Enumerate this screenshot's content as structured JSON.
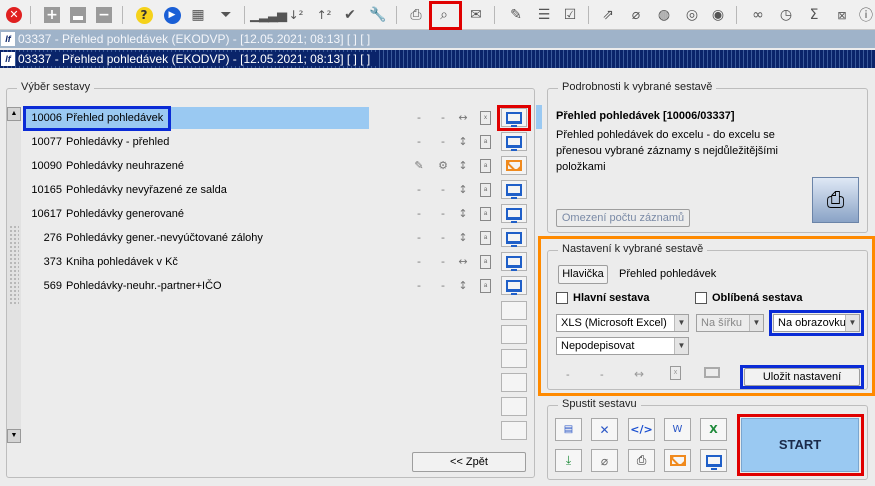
{
  "toolbar": {
    "icons": [
      "close-icon",
      "add-icon",
      "save-icon",
      "remove-icon",
      "help-icon",
      "play-icon",
      "calendar-icon",
      "filter-icon",
      "signal-icon",
      "sort-asc-icon",
      "sort-desc-icon",
      "check-icon",
      "wrench-icon",
      "print-icon",
      "print-preview-icon",
      "mail-icon",
      "edit-icon",
      "list-icon",
      "checklist-icon",
      "export-icon",
      "attach-icon",
      "globe-icon",
      "compass-icon",
      "view-icon",
      "glasses-icon",
      "clock-icon",
      "sum-icon",
      "excel-icon",
      "info-icon"
    ]
  },
  "window1": {
    "title": "03337 - Přehled pohledávek (EKODVP) - [12.05.2021; 08:13]  [ ]  [ ]"
  },
  "window2": {
    "title": "03337 - Přehled pohledávek (EKODVP) - [12.05.2021; 08:13]  [ ]  [ ]"
  },
  "report_list": {
    "label": "Výběr sestavy",
    "items": [
      {
        "code": "10006",
        "name": "Přehled pohledávek",
        "col1": "-",
        "col2": "-",
        "col3": "↔",
        "col4": "xls",
        "output": "monitor",
        "selected": true
      },
      {
        "code": "10077",
        "name": "Pohledávky - přehled",
        "col1": "-",
        "col2": "-",
        "col3": "↕",
        "col4": "pdf",
        "output": "monitor",
        "selected": false
      },
      {
        "code": "10090",
        "name": "Pohledávky neuhrazené",
        "col1": "✎",
        "col2": "⚙",
        "col3": "↕",
        "col4": "pdf",
        "output": "mail",
        "selected": false
      },
      {
        "code": "10165",
        "name": "Pohledávky nevyřazené ze salda",
        "col1": "-",
        "col2": "-",
        "col3": "↕",
        "col4": "pdf",
        "output": "monitor",
        "selected": false
      },
      {
        "code": "10617",
        "name": "Pohledávky generované",
        "col1": "-",
        "col2": "-",
        "col3": "↕",
        "col4": "pdf",
        "output": "monitor",
        "selected": false
      },
      {
        "code": "276",
        "name": "Pohledávky gener.-nevyúčtované zálohy",
        "col1": "-",
        "col2": "-",
        "col3": "↕",
        "col4": "pdf",
        "output": "monitor",
        "selected": false
      },
      {
        "code": "373",
        "name": "Kniha pohledávek v Kč",
        "col1": "-",
        "col2": "-",
        "col3": "↔",
        "col4": "pdf",
        "output": "monitor",
        "selected": false
      },
      {
        "code": "569",
        "name": "Pohledávky-neuhr.-partner+IČO",
        "col1": "-",
        "col2": "-",
        "col3": "↕",
        "col4": "pdf",
        "output": "monitor",
        "selected": false
      }
    ],
    "back_label": "<< Zpět"
  },
  "details": {
    "label": "Podrobnosti k vybrané sestavě",
    "title": "Přehled pohledávek [10006/03337]",
    "description": "Přehled pohledávek do excelu - do excelu se přenesou vybrané záznamy s nejdůležitějšími položkami",
    "limit_label": "Omezení počtu záznamů"
  },
  "settings": {
    "label": "Nastavení k vybrané sestavě",
    "header_btn": "Hlavička",
    "header_value": "Přehled pohledávek",
    "main_label": "Hlavní sestava",
    "favorite_label": "Oblíbená sestava",
    "format": "XLS (Microsoft Excel)",
    "width": "Na šířku",
    "target": "Na obrazovku",
    "signature": "Nepodepisovat",
    "row_icons": [
      "-",
      "-",
      "↔",
      "xls",
      "monitor"
    ],
    "save_label": "Uložit nastavení"
  },
  "run": {
    "label": "Spustit sestavu",
    "start_label": "START",
    "buttons": [
      "pdf-icon",
      "tool-icon",
      "code-icon",
      "word-icon",
      "excel-icon",
      "download-icon",
      "attach-icon",
      "print-icon",
      "mail-icon",
      "monitor-icon"
    ]
  }
}
